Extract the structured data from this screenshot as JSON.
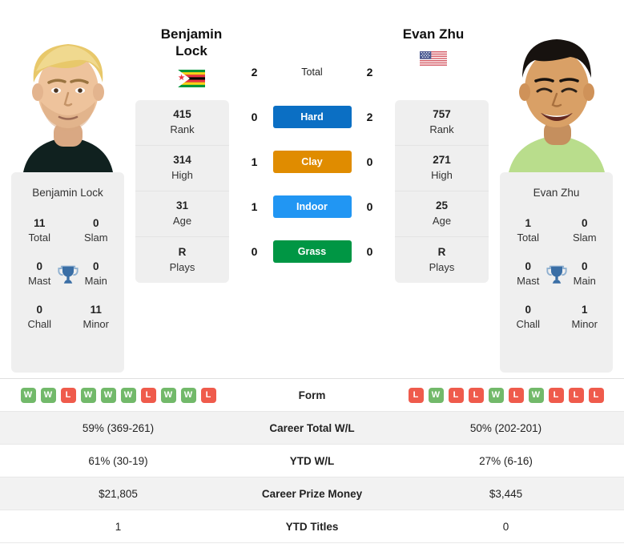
{
  "players": {
    "left": {
      "name": "Benjamin Lock",
      "name_line1": "Benjamin",
      "name_line2": "Lock",
      "flag": "zimbabwe-flag",
      "rank": "415",
      "rank_label": "Rank",
      "high": "314",
      "high_label": "High",
      "age": "31",
      "age_label": "Age",
      "plays": "R",
      "plays_label": "Plays",
      "titles": {
        "total": "11",
        "total_label": "Total",
        "slam": "0",
        "slam_label": "Slam",
        "mast": "0",
        "mast_label": "Mast",
        "main": "0",
        "main_label": "Main",
        "chall": "0",
        "chall_label": "Chall",
        "minor": "11",
        "minor_label": "Minor"
      },
      "form": [
        "W",
        "W",
        "L",
        "W",
        "W",
        "W",
        "L",
        "W",
        "W",
        "L"
      ],
      "career_wl": "59% (369-261)",
      "ytd_wl": "61% (30-19)",
      "prize_money": "$21,805",
      "ytd_titles": "1"
    },
    "right": {
      "name": "Evan Zhu",
      "name_line1": "Evan Zhu",
      "name_line2": "",
      "flag": "usa-flag",
      "rank": "757",
      "rank_label": "Rank",
      "high": "271",
      "high_label": "High",
      "age": "25",
      "age_label": "Age",
      "plays": "R",
      "plays_label": "Plays",
      "titles": {
        "total": "1",
        "total_label": "Total",
        "slam": "0",
        "slam_label": "Slam",
        "mast": "0",
        "mast_label": "Mast",
        "main": "0",
        "main_label": "Main",
        "chall": "0",
        "chall_label": "Chall",
        "minor": "1",
        "minor_label": "Minor"
      },
      "form": [
        "L",
        "W",
        "L",
        "L",
        "W",
        "L",
        "W",
        "L",
        "L",
        "L"
      ],
      "career_wl": "50% (202-201)",
      "ytd_wl": "27% (6-16)",
      "prize_money": "$3,445",
      "ytd_titles": "0"
    }
  },
  "surfaces": [
    {
      "label": "Total",
      "left": "2",
      "right": "2",
      "color": "transparent"
    },
    {
      "label": "Hard",
      "left": "0",
      "right": "2",
      "color": "#0b6fc4"
    },
    {
      "label": "Clay",
      "left": "1",
      "right": "0",
      "color": "#e08c00"
    },
    {
      "label": "Indoor",
      "left": "1",
      "right": "0",
      "color": "#2196f3"
    },
    {
      "label": "Grass",
      "left": "0",
      "right": "0",
      "color": "#009644"
    }
  ],
  "table": {
    "rows": [
      {
        "label": "Form",
        "key": "form"
      },
      {
        "label": "Career Total W/L",
        "key": "career_wl"
      },
      {
        "label": "YTD W/L",
        "key": "ytd_wl"
      },
      {
        "label": "Career Prize Money",
        "key": "prize_money"
      },
      {
        "label": "YTD Titles",
        "key": "ytd_titles"
      }
    ]
  },
  "colors": {
    "win": "#72b96a",
    "loss": "#ef5b4c",
    "trophy": "#3a6ea5",
    "card_bg": "#efefef",
    "row_alt": "#f2f2f2"
  }
}
